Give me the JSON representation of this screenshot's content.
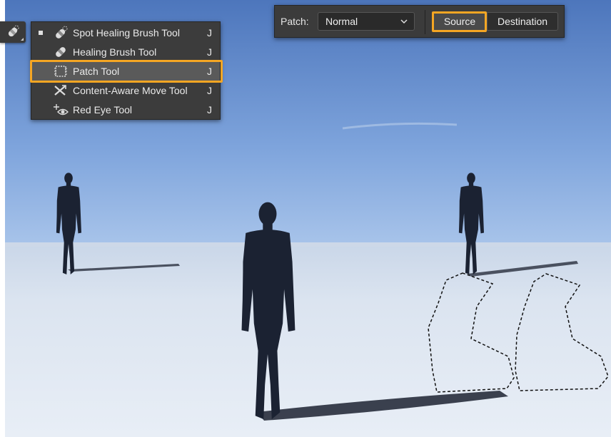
{
  "tool_menu": {
    "items": [
      {
        "label": "Spot Healing Brush Tool",
        "shortcut": "J",
        "icon": "spot-healing-brush-icon",
        "current": true
      },
      {
        "label": "Healing Brush Tool",
        "shortcut": "J",
        "icon": "healing-brush-icon",
        "current": false
      },
      {
        "label": "Patch Tool",
        "shortcut": "J",
        "icon": "patch-icon",
        "current": false,
        "highlighted": true
      },
      {
        "label": "Content-Aware Move Tool",
        "shortcut": "J",
        "icon": "content-aware-move-icon",
        "current": false
      },
      {
        "label": "Red Eye Tool",
        "shortcut": "J",
        "icon": "red-eye-icon",
        "current": false
      }
    ]
  },
  "options_bar": {
    "patch_label": "Patch:",
    "mode_value": "Normal",
    "source_label": "Source",
    "destination_label": "Destination"
  },
  "colors": {
    "highlight": "#f5a623",
    "panel": "#3c3c3c",
    "sky_top": "#4f78bd",
    "ground": "#dfe8f3"
  }
}
